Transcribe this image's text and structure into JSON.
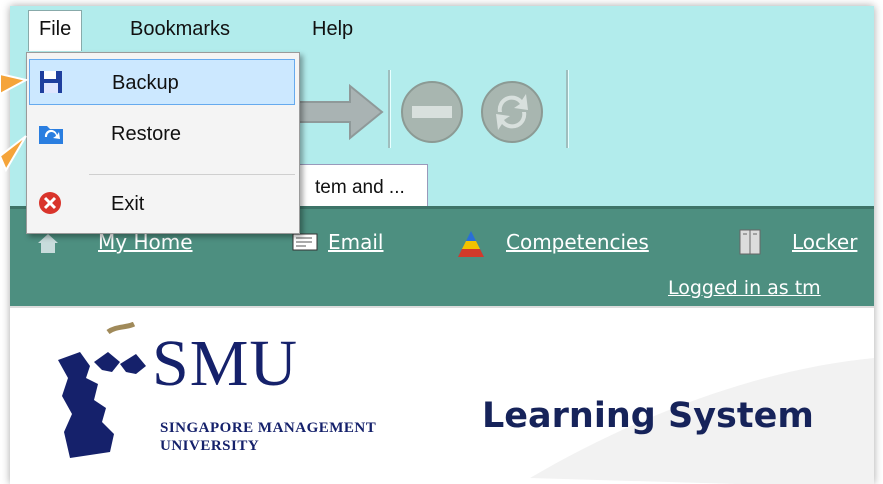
{
  "menubar": {
    "items": [
      {
        "label": "File"
      },
      {
        "label": "Bookmarks"
      },
      {
        "label": "Help"
      }
    ]
  },
  "file_menu": {
    "items": [
      {
        "label": "Backup",
        "icon": "floppy-disk-icon",
        "highlighted": true
      },
      {
        "label": "Restore",
        "icon": "folder-restore-icon"
      },
      {
        "label": "Exit",
        "icon": "red-x-close-icon"
      }
    ]
  },
  "tabs": [
    {
      "label": "tem and ..."
    }
  ],
  "nav": {
    "links": [
      {
        "label": "My Home",
        "icon": "home-icon"
      },
      {
        "label": "Email",
        "icon": "email-icon"
      },
      {
        "label": "Competencies",
        "icon": "pyramid-icon"
      },
      {
        "label": "Locker",
        "icon": "locker-icon"
      }
    ],
    "logged_in": "Logged in as tm"
  },
  "banner": {
    "logo_word": "SMU",
    "logo_sub1": "SINGAPORE MANAGEMENT",
    "logo_sub2": "UNIVERSITY",
    "title": "Learning System"
  },
  "colors": {
    "chrome": "#b2ecec",
    "navbar": "#4d8f80",
    "highlight": "#cce8ff",
    "callout": "#f5a43a",
    "logo_navy": "#15216b"
  }
}
